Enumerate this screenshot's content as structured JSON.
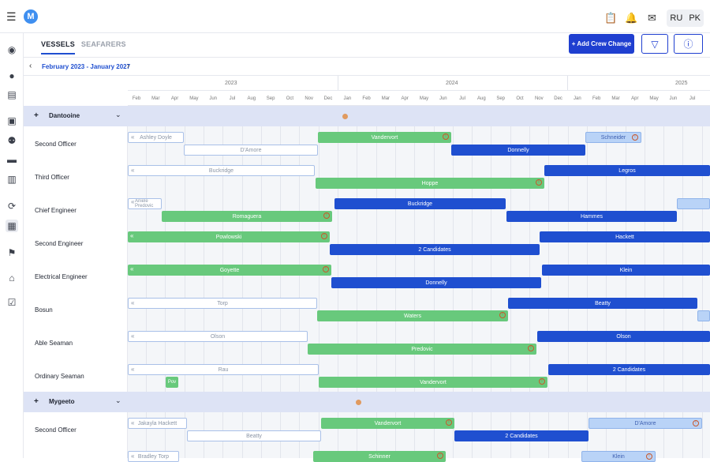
{
  "header": {
    "menu_icon": "menu-icon",
    "logo_letter": "M",
    "lang_ru": "RU",
    "lang_pk": "PK"
  },
  "tabs": [
    {
      "label": "VESSELS"
    },
    {
      "label": "SEAFARERS"
    }
  ],
  "actions": {
    "add_label": "+ Add Crew Change"
  },
  "date_range": "February 2023 - January 2027",
  "years": [
    "2023",
    "2024",
    "2025"
  ],
  "months": [
    "Feb",
    "Mar",
    "Apr",
    "May",
    "Jun",
    "Jul",
    "Aug",
    "Sep",
    "Oct",
    "Nov",
    "Dec",
    "Jan",
    "Feb",
    "Mar",
    "Apr",
    "May",
    "Jun",
    "Jul",
    "Aug",
    "Sep",
    "Oct",
    "Nov",
    "Dec",
    "Jan",
    "Feb",
    "Mar",
    "Apr",
    "May",
    "Jun",
    "Jul"
  ],
  "vessels": [
    {
      "name": "Dantooine",
      "plus": "+"
    },
    {
      "name": "Mygeeto",
      "plus": "+"
    }
  ],
  "roles": [
    "Second Officer",
    "Third Officer",
    "Chief Engineer",
    "Second Engineer",
    "Electrical Engineer",
    "Bosun",
    "Able Seaman",
    "Ordinary Seaman",
    "Second Officer"
  ],
  "bars": [
    "Ashley Doyle",
    "D'Amore",
    "Vandervort",
    "Donnelly",
    "Schneider",
    "Buckridge",
    "Hoppe",
    "Legros",
    "Aniele Predovic",
    "Romaguera",
    "Buckridge",
    "Hammes",
    "Powlowski",
    "2 Candidates",
    "Hackett",
    "Goyette",
    "Donnelly",
    "Klein",
    "Torp",
    "Waters",
    "Beatty",
    "Olson",
    "Predovic",
    "Olson",
    "Rau",
    "Pov",
    "Vandervort",
    "2 Candidates",
    "Jakayla Hackett",
    "Beatty",
    "Vandervort",
    "2 Candidates",
    "D'Amore",
    "Bradley Torp",
    "Schinner",
    "Klein"
  ]
}
